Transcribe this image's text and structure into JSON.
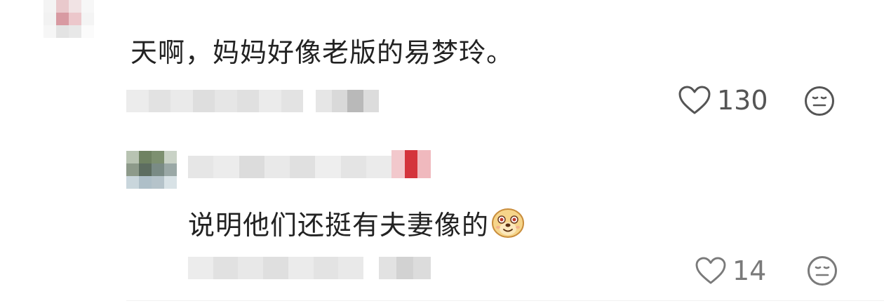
{
  "thread": {
    "main_comment": {
      "text": "天啊，妈妈好像老版的易梦玲。",
      "like_count": "130"
    },
    "reply": {
      "text": "说明他们还挺有夫妻像的",
      "like_count": "14"
    }
  },
  "icons": {
    "like": "heart-outline-icon",
    "emoji_reaction": "neutral-face-icon",
    "inline_emoji": "smiling-dog-face-emoji"
  },
  "colors": {
    "text": "#222222",
    "meta": "#555555",
    "background": "#ffffff"
  }
}
